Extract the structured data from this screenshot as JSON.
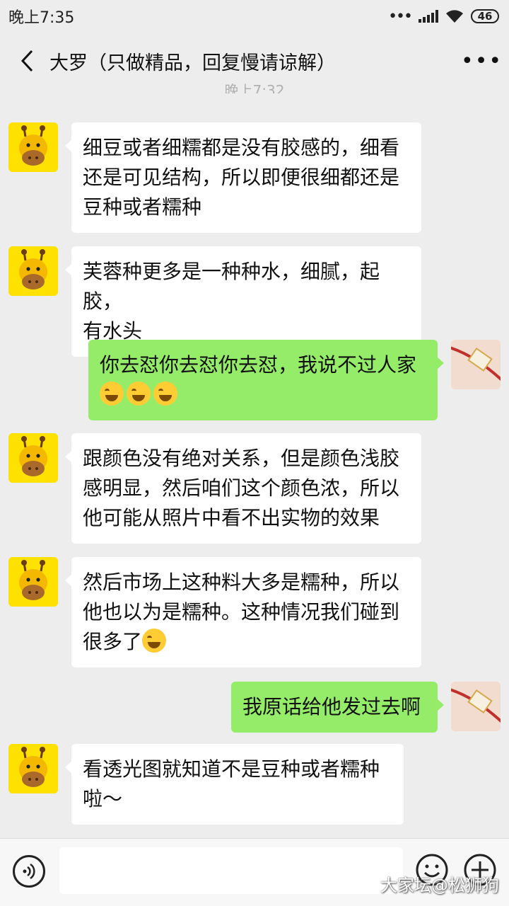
{
  "status_bar": {
    "time": "晚上7:35",
    "battery": "46"
  },
  "header": {
    "title": "大罗（只做精品，回复慢请谅解）"
  },
  "timestamp": "晚上7:32",
  "messages": [
    {
      "side": "in",
      "lines": [
        "细豆或者细糯都是没有胶感的，细看",
        "还是可见结构，所以即便很细都还是",
        "豆种或者糯种"
      ]
    },
    {
      "side": "in",
      "lines": [
        "芙蓉种更多是一种种水，细腻，起胶，",
        "有水头"
      ]
    },
    {
      "side": "out",
      "lines": [
        "你去怼你去怼你去怼，我说不过人家"
      ],
      "emoji": [
        "facepalm-laugh-emoji",
        "facepalm-laugh-emoji",
        "facepalm-laugh-emoji"
      ]
    },
    {
      "side": "in",
      "lines": [
        "跟颜色没有绝对关系，但是颜色浅胶",
        "感明显，然后咱们这个颜色浓，所以",
        "他可能从照片中看不出实物的效果"
      ]
    },
    {
      "side": "in",
      "lines": [
        "然后市场上这种料大多是糯种，所以",
        "他也以为是糯种。这种情况我们碰到",
        "很多了"
      ],
      "emoji": [
        "tears-of-joy-emoji"
      ]
    },
    {
      "side": "out",
      "lines": [
        "我原话给他发过去啊"
      ]
    },
    {
      "side": "in",
      "lines": [
        "看透光图就知道不是豆种或者糯种",
        "啦～"
      ]
    }
  ],
  "icons": {
    "back": "chevron-left-icon",
    "more": "more-icon",
    "voice": "voice-icon",
    "emoji": "emoji-icon",
    "plus": "plus-icon"
  },
  "colors": {
    "outgoing_bubble": "#95ec69",
    "incoming_bubble": "#ffffff",
    "background": "#ededed"
  },
  "watermark": "大家坛@松狮狗"
}
